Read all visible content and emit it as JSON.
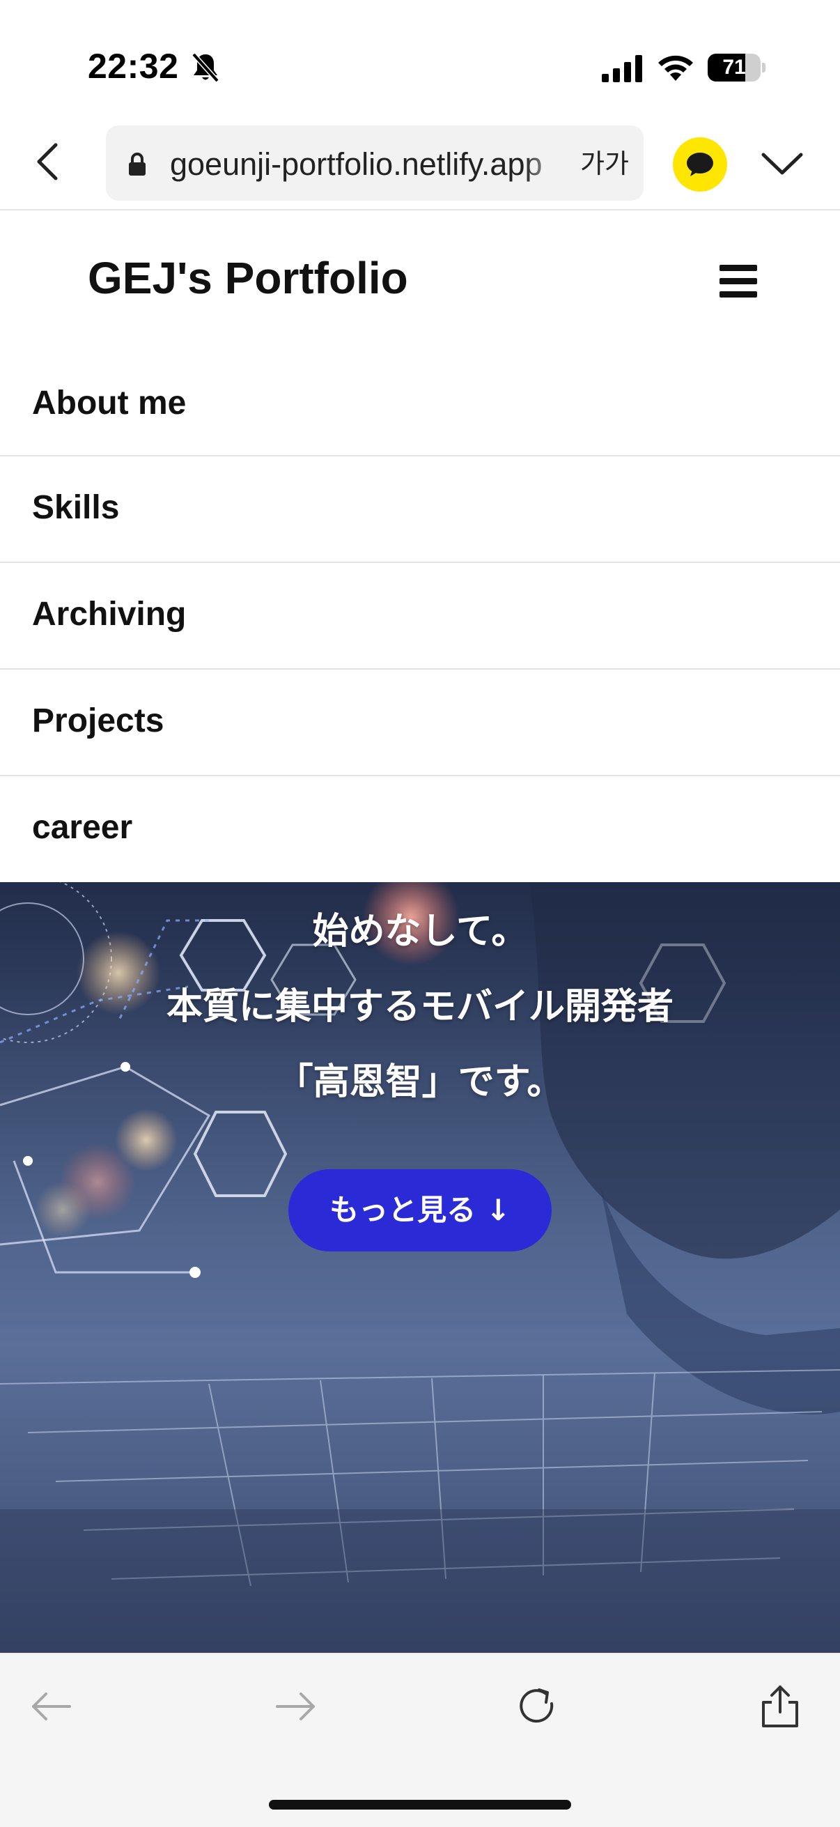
{
  "status_bar": {
    "time": "22:32",
    "battery_level": "71",
    "battery_fraction": 0.71,
    "icons": [
      "bell-slash-icon",
      "cellular-signal-icon",
      "wifi-icon",
      "battery-icon"
    ]
  },
  "browser": {
    "url": "goeunji-portfolio.netlify.app",
    "font_size_label": "가가",
    "icons": [
      "back-arrow-icon",
      "lock-icon",
      "kakaotalk-icon",
      "chevron-down-icon"
    ]
  },
  "site": {
    "title": "GEJ's Portfolio",
    "menu_icon": "hamburger-icon"
  },
  "nav": {
    "items": [
      {
        "label": "About me"
      },
      {
        "label": "Skills"
      },
      {
        "label": "Archiving"
      },
      {
        "label": "Projects"
      },
      {
        "label": "career"
      }
    ]
  },
  "hero": {
    "lines": [
      "始めなして。",
      "本質に集中するモバイル開発者",
      "「高恩智」です。"
    ],
    "more_button": "もっと見る ↓"
  },
  "bottom_toolbar": {
    "icons": [
      "back-icon",
      "forward-icon",
      "reload-icon",
      "share-icon"
    ]
  },
  "colors": {
    "accent_button": "#2a2bd6",
    "kakao_yellow": "#ffe600",
    "hero_base": "#4d5f86"
  }
}
